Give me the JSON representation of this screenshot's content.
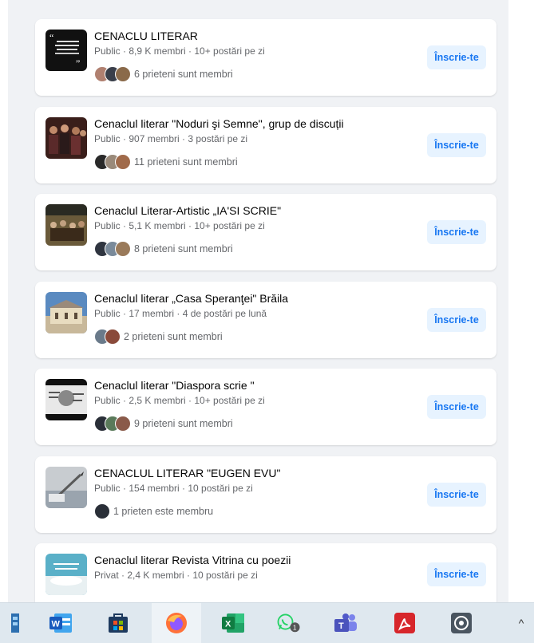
{
  "groups": [
    {
      "name": "CENACLU LITERAR",
      "meta": "Public · 8,9 K membri · 10+ postări pe zi",
      "friends": "6 prieteni sunt membri",
      "join": "Înscrie-te"
    },
    {
      "name": "Cenaclul literar \"Noduri şi Semne\", grup de discuții",
      "meta": "Public · 907 membri · 3 postări pe zi",
      "friends": "11 prieteni sunt membri",
      "join": "Înscrie-te"
    },
    {
      "name": "Cenaclul Literar-Artistic „IA'SI SCRIE\"",
      "meta": "Public · 5,1 K membri · 10+ postări pe zi",
      "friends": "8 prieteni sunt membri",
      "join": "Înscrie-te"
    },
    {
      "name": "Cenaclul literar „Casa Speranţei\" Brăila",
      "meta": "Public · 17 membri · 4 de postări pe lună",
      "friends": "2 prieteni sunt membri",
      "join": "Înscrie-te"
    },
    {
      "name": "Cenaclul literar \"Diaspora scrie \"",
      "meta": "Public · 2,5 K membri · 10+ postări pe zi",
      "friends": "9 prieteni sunt membri",
      "join": "Înscrie-te"
    },
    {
      "name": "CENACLUL LITERAR \"EUGEN EVU\"",
      "meta": "Public · 154 membri · 10 postări pe zi",
      "friends": "1 prieten este membru",
      "join": "Înscrie-te"
    },
    {
      "name": "Cenaclul literar Revista Vitrina cu poezii",
      "meta": "Privat · 2,4 K membri · 10 postări pe zi",
      "friends": "",
      "join": "Înscrie-te"
    }
  ],
  "taskbar": {
    "apps": [
      "file-explorer-icon",
      "word-icon",
      "store-icon",
      "firefox-icon",
      "excel-icon",
      "whatsapp-icon",
      "teams-icon",
      "acrobat-icon",
      "app-icon"
    ],
    "whatsapp_badge": "1",
    "overflow_glyph": "^"
  },
  "colors": {
    "accent": "#1877f2",
    "join_bg": "#e7f3ff",
    "feed_bg": "#f0f2f5"
  }
}
